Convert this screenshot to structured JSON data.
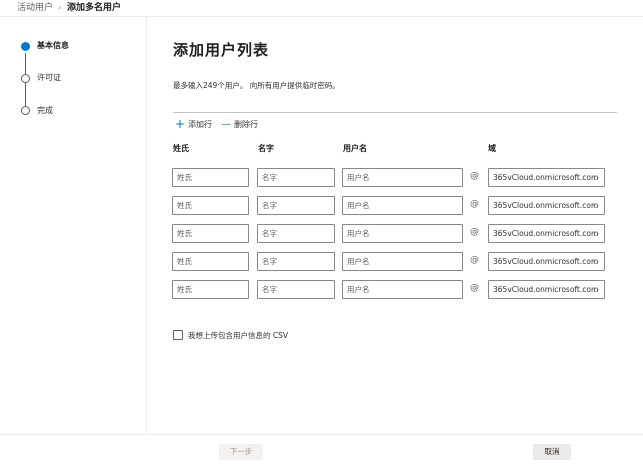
{
  "breadcrumb": {
    "parent": "活动用户",
    "separator": "›",
    "current": "添加多名用户"
  },
  "steps": [
    {
      "label": "基本信息",
      "active": true
    },
    {
      "label": "许可证",
      "active": false
    },
    {
      "label": "完成",
      "active": false
    }
  ],
  "main": {
    "title": "添加用户列表",
    "description": "最多输入249个用户。 向所有用户提供临时密码。",
    "add_row": "添加行",
    "delete_row": "删除行",
    "columns": {
      "last_name": "姓氏",
      "first_name": "名字",
      "username": "用户名",
      "domain": "域"
    },
    "rows": [
      {
        "last_name": "姓氏",
        "first_name": "名字",
        "username": "用户名",
        "at": "@",
        "domain": "365vCloud.onmicrosoft.com"
      },
      {
        "last_name": "姓氏",
        "first_name": "名字",
        "username": "用户名",
        "at": "@",
        "domain": "365vCloud.onmicrosoft.com"
      },
      {
        "last_name": "姓氏",
        "first_name": "名字",
        "username": "用户名",
        "at": "@",
        "domain": "365vCloud.onmicrosoft.com"
      },
      {
        "last_name": "姓氏",
        "first_name": "名字",
        "username": "用户名",
        "at": "@",
        "domain": "365vCloud.onmicrosoft.com"
      },
      {
        "last_name": "姓氏",
        "first_name": "名字",
        "username": "用户名",
        "at": "@",
        "domain": "365vCloud.onmicrosoft.com"
      }
    ],
    "csv_checkbox": "我想上传包含用户信息的 CSV"
  },
  "footer": {
    "next": "下一步",
    "cancel": "取消"
  },
  "colors": {
    "accent": "#0078d4",
    "border": "#8a8886",
    "text": "#323130"
  },
  "icons": {
    "add": "plus-icon",
    "delete": "minus-icon",
    "dropdown": "chevron-down-icon",
    "separator": "chevron-right-icon"
  }
}
